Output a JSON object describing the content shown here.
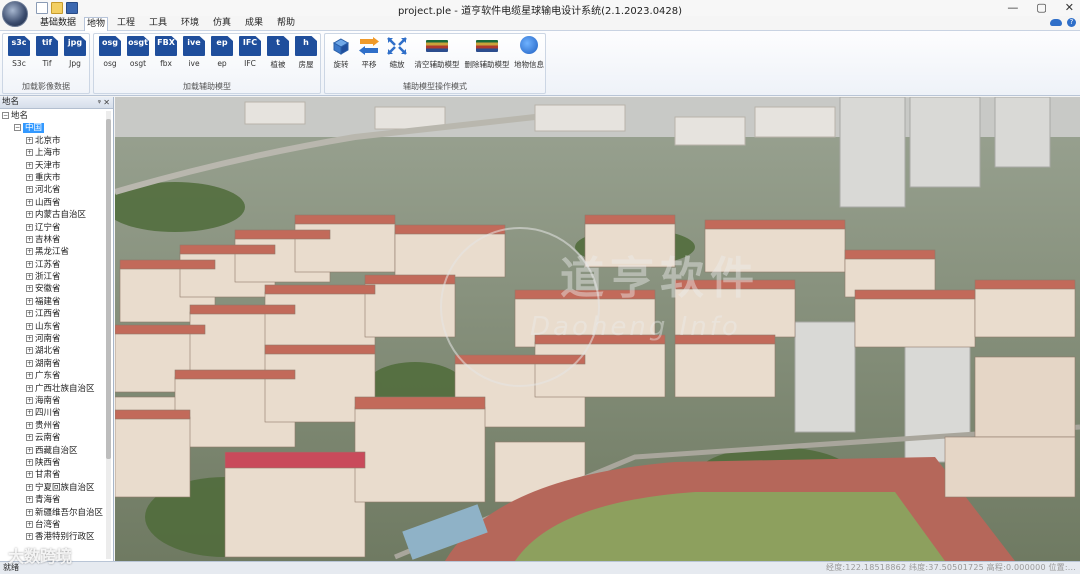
{
  "window": {
    "title": "project.ple - 道亨软件电缆星球输电设计系统(2.1.2023.0428)",
    "controls": [
      "—",
      "▢",
      "✕"
    ]
  },
  "tabs": [
    "基础数据",
    "地物",
    "工程",
    "工具",
    "环境",
    "仿真",
    "成果",
    "帮助"
  ],
  "active_tab": "地物",
  "ribbon": {
    "group_images": {
      "label": "加载影像数据",
      "buttons": [
        {
          "icon_text": "s3c",
          "label": "S3c"
        },
        {
          "icon_text": "tif",
          "label": "Tif"
        },
        {
          "icon_text": "jpg",
          "label": "Jpg"
        }
      ]
    },
    "group_models": {
      "label": "加载辅助模型",
      "buttons": [
        {
          "icon_text": "osg",
          "label": "osg"
        },
        {
          "icon_text": "osgt",
          "label": "osgt"
        },
        {
          "icon_text": "FBX",
          "label": "fbx"
        },
        {
          "icon_text": "ive",
          "label": "ive"
        },
        {
          "icon_text": "ep",
          "label": "ep"
        },
        {
          "icon_text": "IFC",
          "label": "IFC"
        },
        {
          "icon_text": "t",
          "label": "植被"
        },
        {
          "icon_text": "h",
          "label": "房屋"
        }
      ]
    },
    "group_ops": {
      "label": "辅助模型操作模式",
      "buttons": [
        {
          "label": "旋转",
          "icon": "rotate-icon"
        },
        {
          "label": "平移",
          "icon": "move-icon"
        },
        {
          "label": "缩放",
          "icon": "scale-icon"
        },
        {
          "label": "清空辅助模型",
          "icon": "clear-models-icon"
        },
        {
          "label": "删除辅助模型",
          "icon": "delete-model-icon"
        },
        {
          "label": "地物信息",
          "icon": "globe-icon"
        }
      ]
    }
  },
  "panel": {
    "title": "地名",
    "pin": "ᵠ",
    "close": "✕",
    "root": "地名",
    "country": "中国",
    "regions": [
      "北京市",
      "上海市",
      "天津市",
      "重庆市",
      "河北省",
      "山西省",
      "内蒙古自治区",
      "辽宁省",
      "吉林省",
      "黑龙江省",
      "江苏省",
      "浙江省",
      "安徽省",
      "福建省",
      "江西省",
      "山东省",
      "河南省",
      "湖北省",
      "湖南省",
      "广东省",
      "广西壮族自治区",
      "海南省",
      "四川省",
      "贵州省",
      "云南省",
      "西藏自治区",
      "陕西省",
      "甘肃省",
      "宁夏回族自治区",
      "青海省",
      "新疆维吾尔自治区",
      "台湾省",
      "香港特别行政区"
    ]
  },
  "viewport": {
    "watermark_cn": "道亨软件",
    "watermark_en": "Daoheng Info"
  },
  "status": {
    "left": "就绪",
    "right": "经度:122.18518862 纬度:37.50501725 高程:0.000000 位置:..."
  },
  "overlay": "大数跨境",
  "colors": {
    "accent": "#3399ff",
    "ribbon_icon": "#1f4e9c"
  }
}
